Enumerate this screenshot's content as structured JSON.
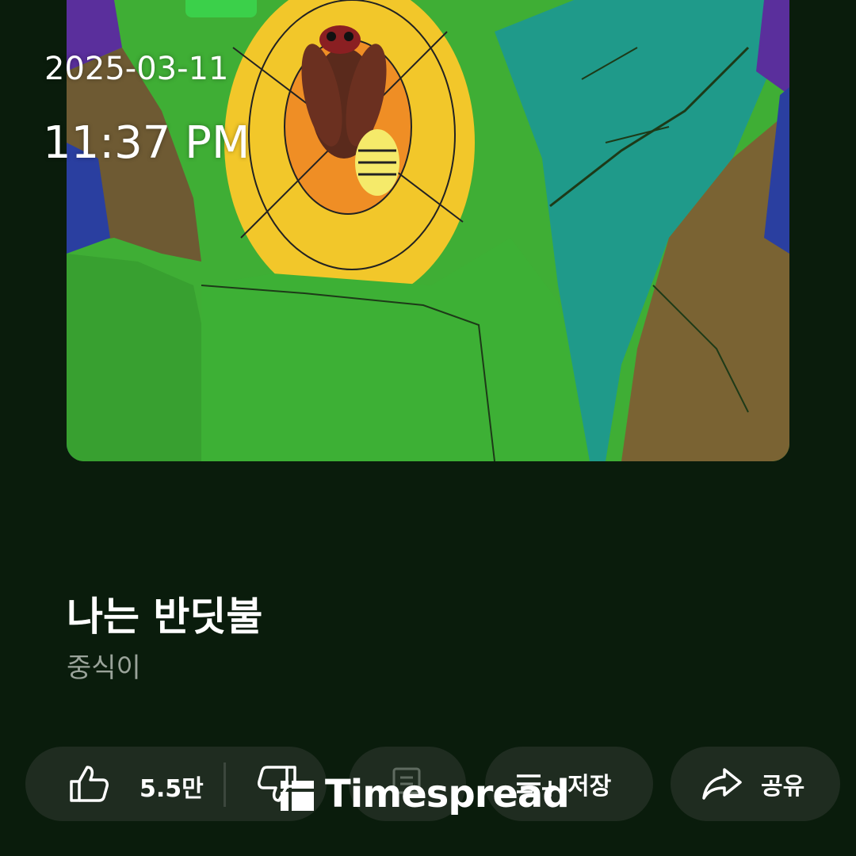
{
  "overlay": {
    "date": "2025-03-11",
    "time": "11:37 PM"
  },
  "artwork": {
    "subject": "hand-drawn firefly on leaves",
    "icon": "artwork-image"
  },
  "song": {
    "title": "나는 반딧불",
    "artist": "중식이"
  },
  "actions": {
    "like": {
      "icon": "thumbs-up-icon",
      "count": "5.5만"
    },
    "dislike": {
      "icon": "thumbs-down-icon"
    },
    "comment": {
      "icon": "comment-icon"
    },
    "save": {
      "icon": "playlist-add-icon",
      "label": "저장"
    },
    "share": {
      "icon": "share-arrow-icon",
      "label": "공유"
    }
  },
  "watermark": {
    "text": "Timespread"
  },
  "colors": {
    "background": "#0a1c0c",
    "pill": "#1f2c20",
    "secondary_text": "#9aa39a"
  }
}
